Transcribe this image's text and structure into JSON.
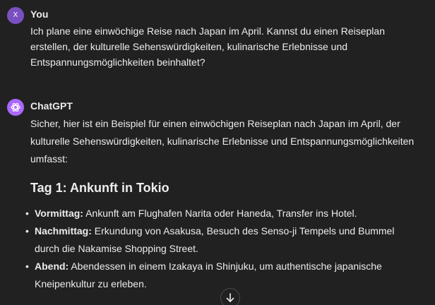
{
  "user": {
    "avatar_initial": "X",
    "name": "You",
    "message": "Ich plane eine einwöchige Reise nach Japan im April. Kannst du einen Reiseplan erstellen, der kulturelle Sehenswürdigkeiten, kulinarische Erlebnisse und Entspannungsmöglichkeiten beinhaltet?"
  },
  "assistant": {
    "name": "ChatGPT",
    "intro": "Sicher, hier ist ein Beispiel für einen einwöchigen Reiseplan nach Japan im April, der kulturelle Sehenswürdigkeiten, kulinarische Erlebnisse und Entspannungsmöglichkeiten umfasst:",
    "day_heading": "Tag 1: Ankunft in Tokio",
    "items": [
      {
        "label": "Vormittag:",
        "text": " Ankunft am Flughafen Narita oder Haneda, Transfer ins Hotel."
      },
      {
        "label": "Nachmittag:",
        "text": " Erkundung von Asakusa, Besuch des Senso-ji Tempels und Bummel durch die Nakamise Shopping Street."
      },
      {
        "label": "Abend:",
        "text": " Abendessen in einem Izakaya in Shinjuku, um authentische japanische Kneipenkultur zu erleben."
      }
    ]
  },
  "icons": {
    "assistant_logo": "openai-logo-icon",
    "scroll": "arrow-down-icon"
  },
  "colors": {
    "background": "#212121",
    "text": "#ececec",
    "user_avatar": "#7a4fc0",
    "assistant_avatar": "#ab68ff"
  }
}
